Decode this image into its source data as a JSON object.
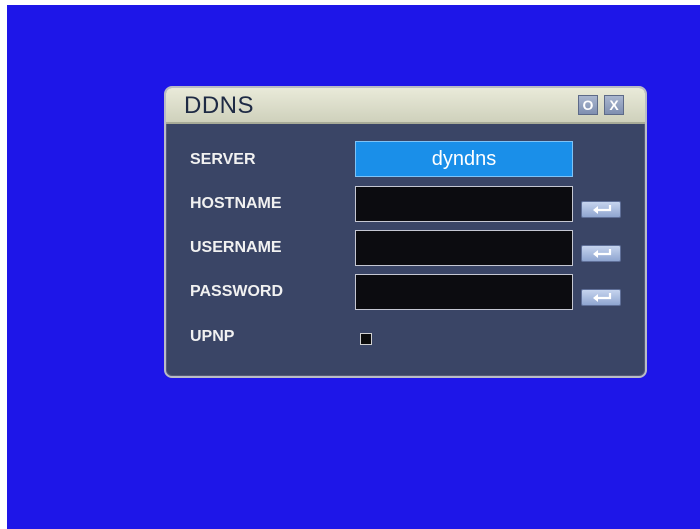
{
  "dialog": {
    "title": "DDNS",
    "buttons": {
      "option": "O",
      "close": "X"
    }
  },
  "fields": {
    "server": {
      "label": "SERVER",
      "value": "dyndns"
    },
    "hostname": {
      "label": "HOSTNAME",
      "value": ""
    },
    "username": {
      "label": "USERNAME",
      "value": ""
    },
    "password": {
      "label": "PASSWORD",
      "value": ""
    },
    "upnp": {
      "label": "UPNP",
      "checked": false
    }
  },
  "icons": {
    "enter": "enter-icon"
  },
  "colors": {
    "background": "#1e16e8",
    "dialog_body": "#3a4566",
    "title_bar": "#e0e2cf",
    "server_selected": "#1a8fe9"
  }
}
